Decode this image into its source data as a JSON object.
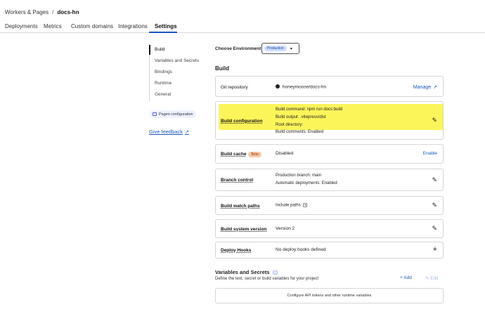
{
  "breadcrumb": {
    "parent": "Workers & Pages",
    "separator": "/",
    "current": "docs-hn"
  },
  "tabs": [
    {
      "label": "Deployments"
    },
    {
      "label": "Metrics"
    },
    {
      "label": "Custom domains"
    },
    {
      "label": "Integrations"
    },
    {
      "label": "Settings",
      "active": true
    }
  ],
  "sidenav": {
    "items": [
      {
        "label": "Build",
        "active": true
      },
      {
        "label": "Variables and Secrets"
      },
      {
        "label": "Bindings"
      },
      {
        "label": "Runtime"
      },
      {
        "label": "General"
      }
    ],
    "pages_config_label": "Pages configuration",
    "feedback_label": "Give feedback"
  },
  "environment": {
    "label": "Choose Environment:",
    "selected": "Production"
  },
  "build_section": {
    "title": "Build",
    "git_repo": {
      "label": "Git repository",
      "value": "honeymoose/docs-hn",
      "action": "Manage"
    },
    "build_config": {
      "label": "Build configuration",
      "lines": [
        "Build command: npm run docs:build",
        "Build output: .vitepress/dist",
        "Root directory:",
        "Build comments: Enabled"
      ]
    },
    "build_cache": {
      "label": "Build cache",
      "badge": "Beta",
      "value": "Disabled",
      "action": "Enable"
    },
    "branch_control": {
      "label": "Branch control",
      "production_branch_label": "Production branch:",
      "production_branch_value": "main",
      "auto_deploy_label": "Automatic deployments:",
      "auto_deploy_value": "Enabled"
    },
    "watch_paths": {
      "label": "Build watch paths",
      "value": "Include paths:"
    },
    "system_version": {
      "label": "Build system version",
      "value": "Version 2"
    },
    "deploy_hooks": {
      "label": "Deploy Hooks",
      "value": "No deploy hooks defined"
    }
  },
  "variables": {
    "title": "Variables and Secrets",
    "subtitle": "Define the text, secret or build variables for your project",
    "add_label": "+ Add",
    "edit_label": "Edit",
    "footer_text": "Configure API tokens and other runtime variables"
  },
  "colors": {
    "accent": "#1a56c4",
    "highlight": "#fbf55a",
    "beta_badge": "#f6c8a8"
  }
}
